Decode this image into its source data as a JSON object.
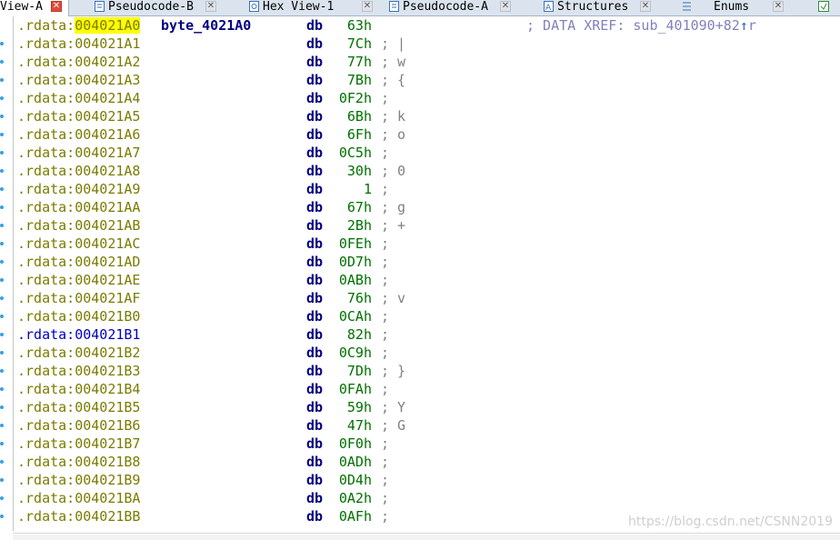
{
  "tabs": [
    {
      "label": "View-A",
      "active": true
    },
    {
      "label": "Pseudocode-B"
    },
    {
      "label": "Hex View-1"
    },
    {
      "label": "Pseudocode-A"
    },
    {
      "label": "Structures"
    },
    {
      "label": "Enums"
    }
  ],
  "xref": {
    "text": "; DATA XREF: sub_401090+82",
    "arrow": "↑",
    "suffix": "r"
  },
  "first_label": "byte_4021A0",
  "rows": [
    {
      "seg": ".rdata:",
      "addr": "004021A0",
      "mnem": "db",
      "val": "63h",
      "cmt": ""
    },
    {
      "seg": ".rdata:",
      "addr": "004021A1",
      "mnem": "db",
      "val": "7Ch",
      "cmt": "|"
    },
    {
      "seg": ".rdata:",
      "addr": "004021A2",
      "mnem": "db",
      "val": "77h",
      "cmt": "w"
    },
    {
      "seg": ".rdata:",
      "addr": "004021A3",
      "mnem": "db",
      "val": "7Bh",
      "cmt": "{"
    },
    {
      "seg": ".rdata:",
      "addr": "004021A4",
      "mnem": "db",
      "val": "0F2h",
      "cmt": ""
    },
    {
      "seg": ".rdata:",
      "addr": "004021A5",
      "mnem": "db",
      "val": "6Bh",
      "cmt": "k"
    },
    {
      "seg": ".rdata:",
      "addr": "004021A6",
      "mnem": "db",
      "val": "6Fh",
      "cmt": "o"
    },
    {
      "seg": ".rdata:",
      "addr": "004021A7",
      "mnem": "db",
      "val": "0C5h",
      "cmt": ""
    },
    {
      "seg": ".rdata:",
      "addr": "004021A8",
      "mnem": "db",
      "val": "30h",
      "cmt": "0"
    },
    {
      "seg": ".rdata:",
      "addr": "004021A9",
      "mnem": "db",
      "val": "1",
      "cmt": ""
    },
    {
      "seg": ".rdata:",
      "addr": "004021AA",
      "mnem": "db",
      "val": "67h",
      "cmt": "g"
    },
    {
      "seg": ".rdata:",
      "addr": "004021AB",
      "mnem": "db",
      "val": "2Bh",
      "cmt": "+"
    },
    {
      "seg": ".rdata:",
      "addr": "004021AC",
      "mnem": "db",
      "val": "0FEh",
      "cmt": ""
    },
    {
      "seg": ".rdata:",
      "addr": "004021AD",
      "mnem": "db",
      "val": "0D7h",
      "cmt": ""
    },
    {
      "seg": ".rdata:",
      "addr": "004021AE",
      "mnem": "db",
      "val": "0ABh",
      "cmt": ""
    },
    {
      "seg": ".rdata:",
      "addr": "004021AF",
      "mnem": "db",
      "val": "76h",
      "cmt": "v"
    },
    {
      "seg": ".rdata:",
      "addr": "004021B0",
      "mnem": "db",
      "val": "0CAh",
      "cmt": ""
    },
    {
      "seg": ".rdata:",
      "addr": "004021B1",
      "mnem": "db",
      "val": "82h",
      "cmt": ""
    },
    {
      "seg": ".rdata:",
      "addr": "004021B2",
      "mnem": "db",
      "val": "0C9h",
      "cmt": ""
    },
    {
      "seg": ".rdata:",
      "addr": "004021B3",
      "mnem": "db",
      "val": "7Dh",
      "cmt": "}"
    },
    {
      "seg": ".rdata:",
      "addr": "004021B4",
      "mnem": "db",
      "val": "0FAh",
      "cmt": ""
    },
    {
      "seg": ".rdata:",
      "addr": "004021B5",
      "mnem": "db",
      "val": "59h",
      "cmt": "Y"
    },
    {
      "seg": ".rdata:",
      "addr": "004021B6",
      "mnem": "db",
      "val": "47h",
      "cmt": "G"
    },
    {
      "seg": ".rdata:",
      "addr": "004021B7",
      "mnem": "db",
      "val": "0F0h",
      "cmt": ""
    },
    {
      "seg": ".rdata:",
      "addr": "004021B8",
      "mnem": "db",
      "val": "0ADh",
      "cmt": ""
    },
    {
      "seg": ".rdata:",
      "addr": "004021B9",
      "mnem": "db",
      "val": "0D4h",
      "cmt": ""
    },
    {
      "seg": ".rdata:",
      "addr": "004021BA",
      "mnem": "db",
      "val": "0A2h",
      "cmt": ""
    },
    {
      "seg": ".rdata:",
      "addr": "004021BB",
      "mnem": "db",
      "val": "0AFh",
      "cmt": ""
    }
  ],
  "cursor_row_addr": "004021B1",
  "highlight_addr": "004021A0",
  "comment_marker": ";",
  "watermark": "https://blog.csdn.net/CSNN2019",
  "colors": {
    "segment": "#7b7b00",
    "highlight": "#ffff00",
    "mnemonic": "#000080",
    "value": "#007000",
    "comment": "#808080",
    "cursor_row": "#0000c0"
  }
}
